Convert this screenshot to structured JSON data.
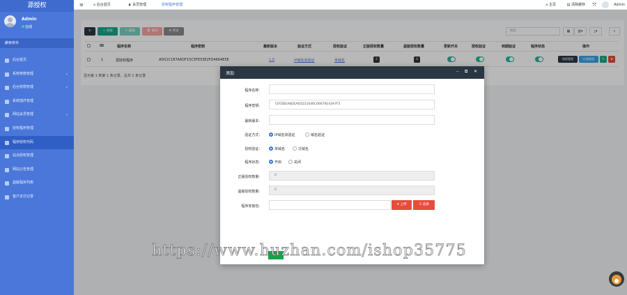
{
  "sidebar": {
    "brand": "源授权",
    "user_name": "Admin",
    "user_status": "在线",
    "search_placeholder": "搜索菜单",
    "items": [
      {
        "label": "后台首页",
        "arrow": ""
      },
      {
        "label": "系统参数管理",
        "arrow": "‹"
      },
      {
        "label": "后台权限管理",
        "arrow": "‹"
      },
      {
        "label": "系统插件管理",
        "arrow": ""
      },
      {
        "label": "网站会员管理",
        "arrow": "‹"
      },
      {
        "label": "授权程序管理",
        "arrow": ""
      },
      {
        "label": "程序授权代码",
        "arrow": ""
      },
      {
        "label": "站点授权管理",
        "arrow": ""
      },
      {
        "label": "网站公告管理",
        "arrow": ""
      },
      {
        "label": "盗版程序列表",
        "arrow": ""
      },
      {
        "label": "客户支付记录",
        "arrow": ""
      }
    ]
  },
  "header": {
    "nav": [
      "后台首页",
      "会员管理",
      "授权程序管理"
    ],
    "home": "主页",
    "clear_cache": "清除缓存",
    "user": "Admin"
  },
  "toolbar": {
    "add": "+ 添加",
    "edit": "✎ 编辑",
    "delete": "🗑 删除",
    "more": "⚙ 更多",
    "search_placeholder": "搜索"
  },
  "table": {
    "headers": [
      "ID",
      "程序名称",
      "程序密钥",
      "最新版本",
      "验证方式",
      "授权验证",
      "正版授权数量",
      "盗版授权数量",
      "更新开关",
      "授权验证",
      "到期验证",
      "程序状态",
      "操作"
    ],
    "row": {
      "id": "1",
      "name": "源授权程序",
      "key": "AD01C187A6DF15C5FE53E2FD4664E5E",
      "version": "1.0",
      "verify_method": "IP域名双验证",
      "auth_verify": "单域名",
      "genuine_count": "2",
      "pirate_count": "0",
      "op_auth": "授权管理",
      "op_price": "价格管理"
    },
    "footer": "显示第 1 到第 1 条记录，总共 1 条记录"
  },
  "modal": {
    "title": "添加",
    "fields": {
      "name_label": "程序名称:",
      "name_value": "",
      "key_label": "程序密钥:",
      "key_value": "72FDDEA8DEA65D11646C06670E43A7F5",
      "version_label": "最新版本:",
      "version_value": "",
      "method_label": "验证方式:",
      "method_opt1": "IP域名双验证",
      "method_opt2": "域名验证",
      "auth_label": "授权验证:",
      "auth_opt1": "单域名",
      "auth_opt2": "泛域名",
      "status_label": "程序状态:",
      "status_opt1": "开启",
      "status_opt2": "关闭",
      "genuine_label": "正版授权数量:",
      "genuine_value": "0",
      "pirate_label": "盗版授权数量:",
      "pirate_value": "0",
      "package_label": "程序安装包:",
      "upload": "上传",
      "choose": "选择"
    }
  },
  "watermark": "https://www.huzhan.com/ishop35775",
  "colors": {
    "sidebar": "#4a77d9",
    "primary_btn": "#2b3643",
    "add_btn": "#18a689",
    "edit_btn": "#78d0be",
    "delete_btn": "#f5a3a0",
    "more_btn": "#8a8a8a",
    "switch_on": "#1bbc9b",
    "danger": "#e74c3c"
  }
}
